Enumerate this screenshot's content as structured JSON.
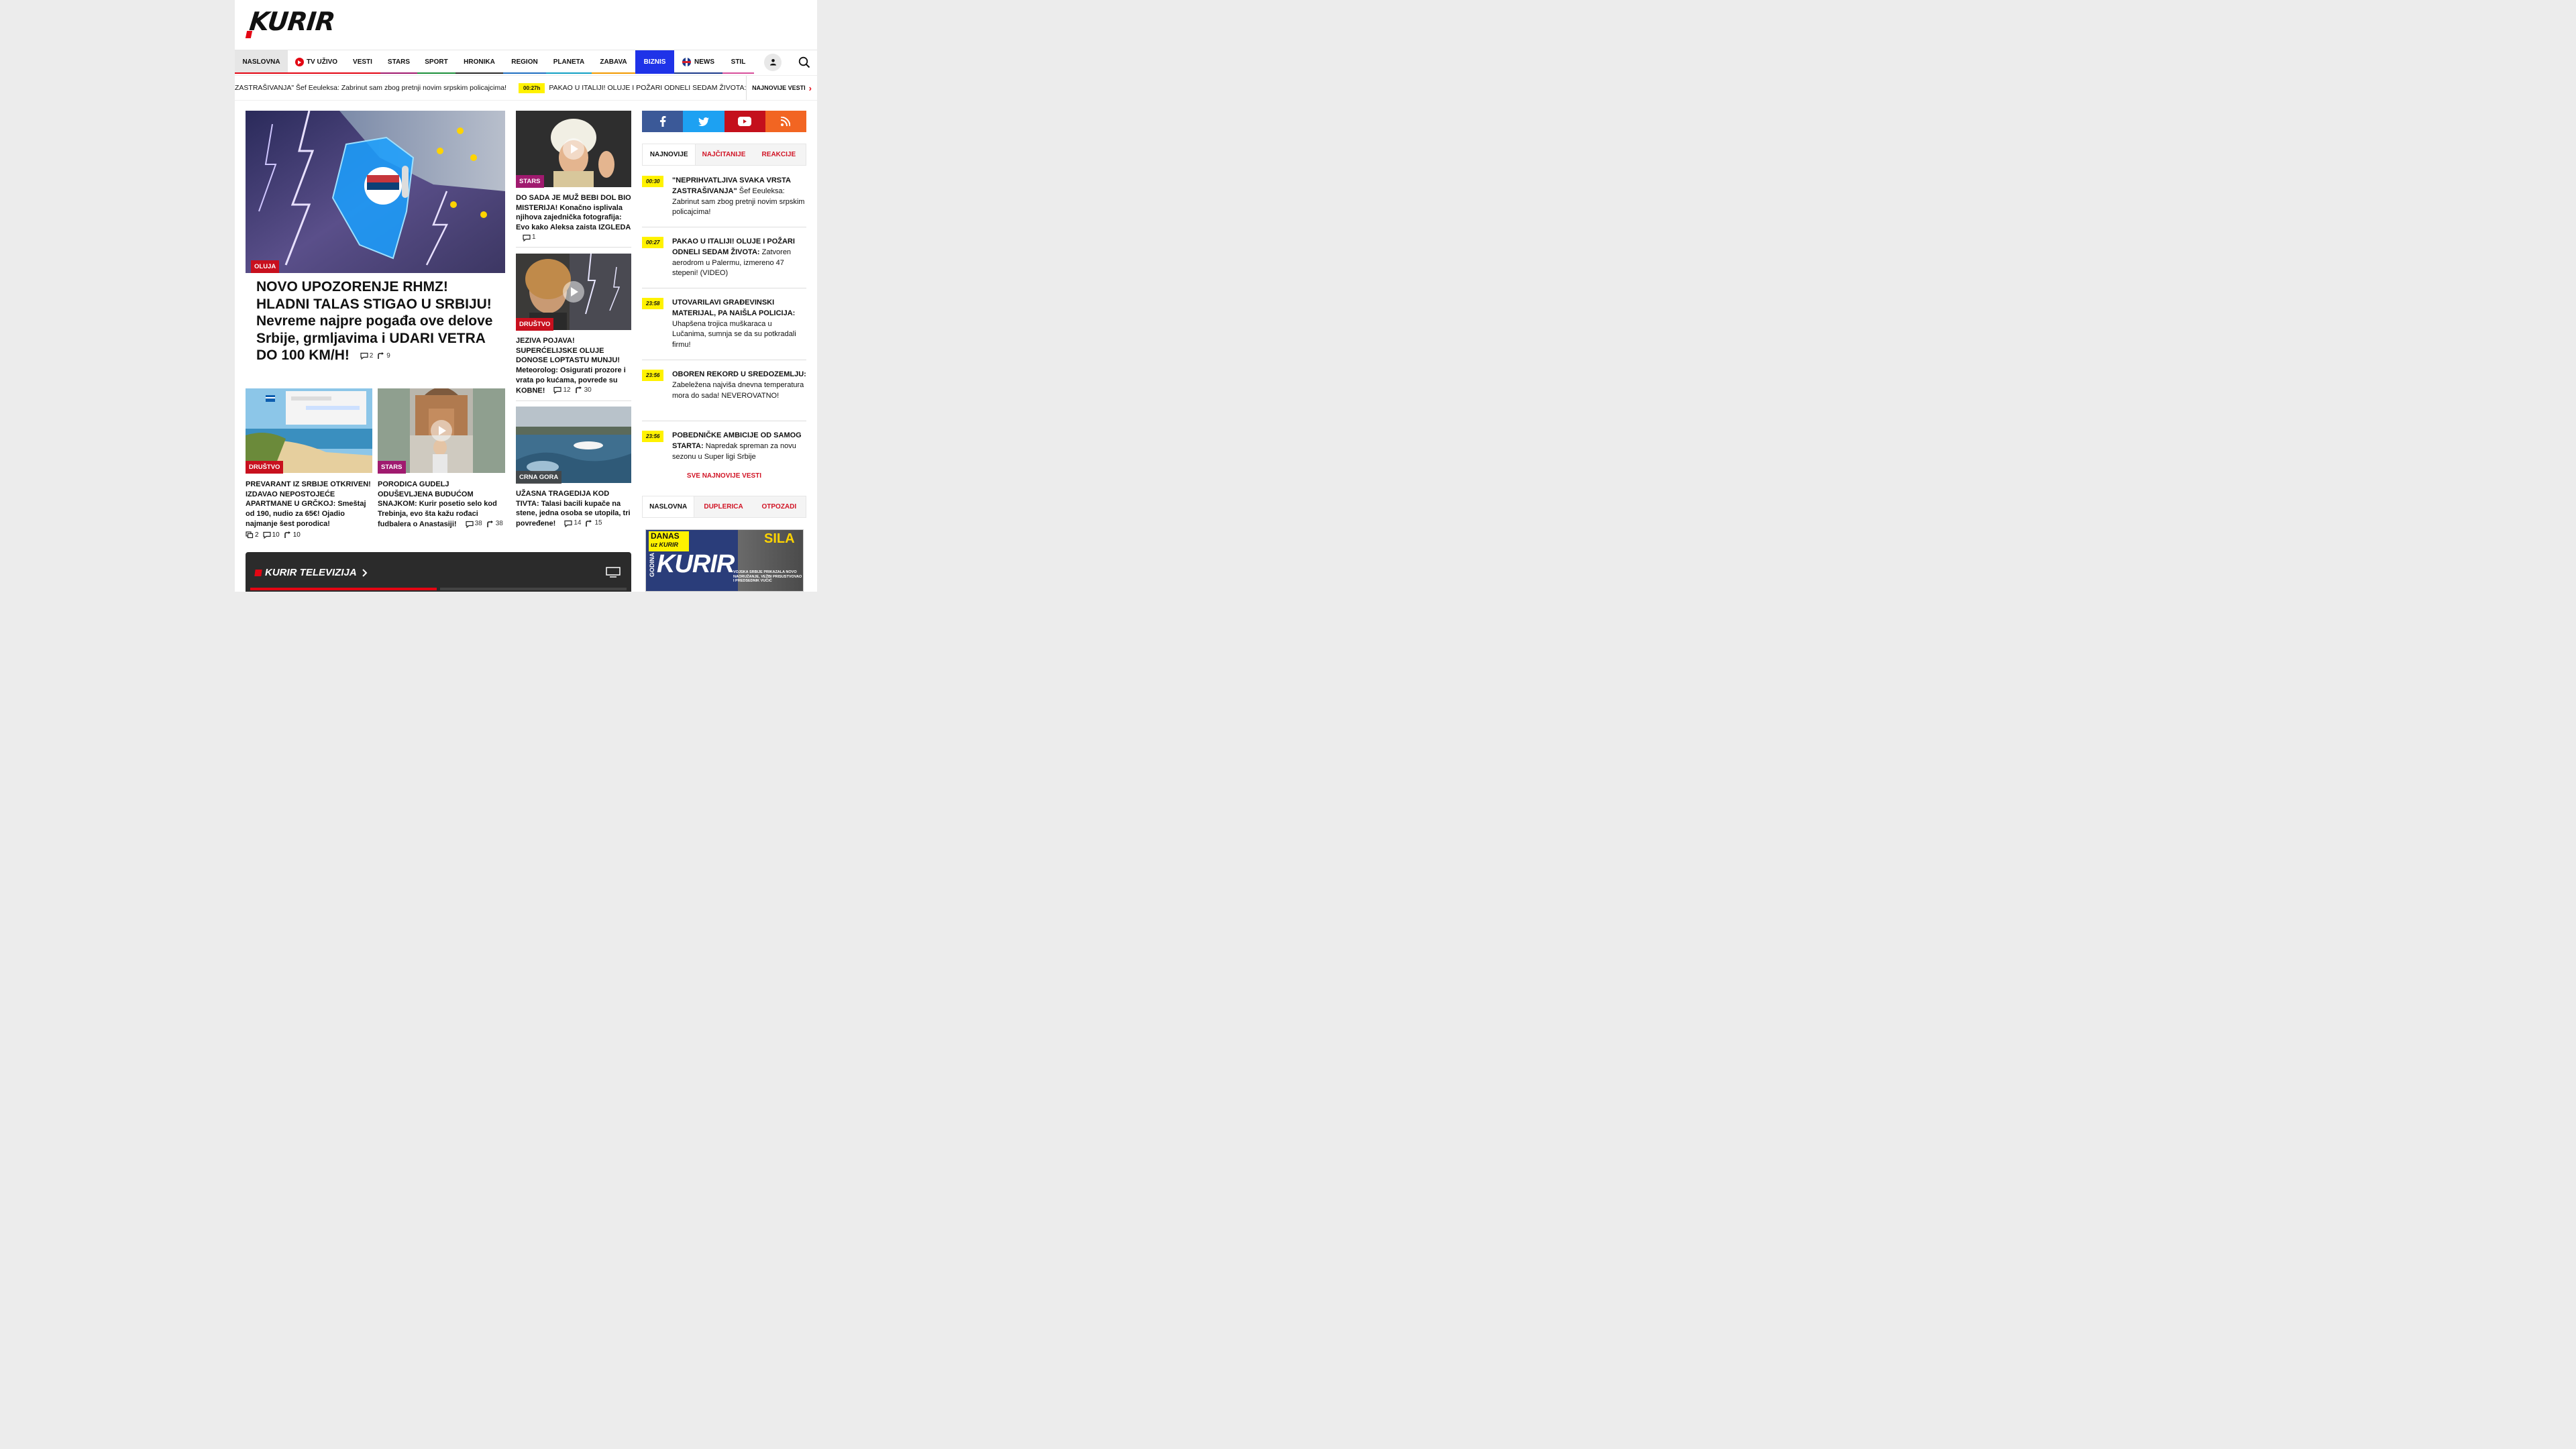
{
  "brand": {
    "logo_text": "KURIR",
    "accent": "#e30613"
  },
  "nav": {
    "items": [
      {
        "label": "NASLOVNA",
        "color": "#e30613"
      },
      {
        "label": "TV UŽIVO",
        "color": "#e30613"
      },
      {
        "label": "VESTI",
        "color": "#e30613"
      },
      {
        "label": "STARS",
        "color": "#a01a6f"
      },
      {
        "label": "SPORT",
        "color": "#1c8f3a"
      },
      {
        "label": "HRONIKA",
        "color": "#2b2b2b"
      },
      {
        "label": "REGION",
        "color": "#1f6fc1"
      },
      {
        "label": "PLANETA",
        "color": "#12a0c4"
      },
      {
        "label": "ZABAVA",
        "color": "#f29a00"
      },
      {
        "label": "BIZNIS",
        "color": "#1f33e8"
      },
      {
        "label": "NEWS",
        "color": "#1d3b8c"
      },
      {
        "label": "STIL",
        "color": "#d84f9b"
      }
    ]
  },
  "ticker": {
    "items": [
      {
        "time": "",
        "text": "ZASTRAŠIVANJA\" Šef Eeuleksa: Zabrinut sam zbog pretnji novim srpskim policajcima!"
      },
      {
        "time": "00:27h",
        "text": "PAKAO U ITALIJI! OLUJE I POŽARI ODNELI SEDAM ŽIVOTA: Zatvoren ae"
      }
    ],
    "more_label": "NAJNOVIJE VESTI"
  },
  "hero": {
    "category": "OLUJA",
    "title_part1": "NOVO UPOZORENJE RHMZ! HLADNI TALAS STIGAO U SRBIJU!",
    "title_part2": "Nevreme najpre pogađa ove delove Srbije, grmljavima i UDARI VETRA DO 100 KM/H!",
    "comments": "2",
    "shares": "9"
  },
  "cards_right": [
    {
      "category": "STARS",
      "title_bold": "DO SADA JE MUŽ BEBI DOL BIO MISTERIJA!",
      "title_rest": "Konačno isplivala njihova zajednička fotografija: Evo kako Aleksa zaista IZGLEDA",
      "comments": "1",
      "shares": ""
    },
    {
      "category": "DRUŠTVO",
      "title_bold": "JEZIVA POJAVA! SUPERĆELIJSKE OLUJE DONOSE LOPTASTU MUNJU!",
      "title_rest": "Meteorolog: Osigurati prozore i vrata po kućama, povrede su KOBNE!",
      "comments": "12",
      "shares": "30"
    },
    {
      "category": "CRNA GORA",
      "title_bold": "UŽASNA TRAGEDIJA KOD TIVTA:",
      "title_rest": "Talasi bacili kupače na stene, jedna osoba se utopila, tri povređene!",
      "comments": "14",
      "shares": "15"
    }
  ],
  "cards_bottom": [
    {
      "category": "DRUŠTVO",
      "title_bold": "PREVARANT IZ SRBIJE OTKRIVEN! IZDAVAO NEPOSTOJEĆE APARTMANE U GRČKOJ:",
      "title_rest": "Smeštaj od 190, nudio za 65€! Ojadio najmanje šest porodica!",
      "gallery": "2",
      "comments": "10",
      "shares": "10"
    },
    {
      "category": "STARS",
      "title_bold": "PORODICA GUDELJ ODUŠEVLJENA BUDUĆOM SNAJKOM:",
      "title_rest": "Kurir posetio selo kod Trebinja, evo šta kažu rođaci fudbalera o Anastasiji!",
      "comments": "38",
      "shares": "38"
    }
  ],
  "tv": {
    "title": "KURIR TELEVIZIJA"
  },
  "sidebar": {
    "tabs": [
      {
        "label": "NAJNOVIJE"
      },
      {
        "label": "NAJČITANIJE"
      },
      {
        "label": "REAKCIJE"
      }
    ],
    "news": [
      {
        "time": "00:30",
        "bold": "\"NEPRIHVATLJIVA SVAKA VRSTA ZASTRAŠIVANJA\"",
        "rest": "Šef Eeuleksa: Zabrinut sam zbog pretnji novim srpskim policajcima!"
      },
      {
        "time": "00:27",
        "bold": "PAKAO U ITALIJI! OLUJE I POŽARI ODNELI SEDAM ŽIVOTA:",
        "rest": "Zatvoren aerodrom u Palermu, izmereno 47 stepeni! (VIDEO)"
      },
      {
        "time": "23:58",
        "bold": "UTOVARILAVI GRAĐEVINSKI MATERIJAL, PA NAIŠLA POLICIJA:",
        "rest": "Uhapšena trojica muškaraca u Lučanima, sumnja se da su potkradali firmu!"
      },
      {
        "time": "23:56",
        "bold": "OBOREN REKORD U SREDOZEMLJU:",
        "rest": "Zabeležena najviša dnevna temperatura mora do sada! NEVEROVATNO!"
      },
      {
        "time": "23:56",
        "bold": "POBEDNIČKE AMBICIJE OD SAMOG STARTA:",
        "rest": "Napredak spreman za novu sezonu u Super ligi Srbije"
      }
    ],
    "all_news": "SVE NAJNOVIJE VESTI",
    "tabs2": [
      {
        "label": "NASLOVNA"
      },
      {
        "label": "DUPLERICA"
      },
      {
        "label": "OTPOZADI"
      }
    ],
    "paper": {
      "danas": "DANAS",
      "uz": "uz",
      "kurir": "KURIR",
      "sila": "SILA",
      "godina": "GODINA",
      "headline": "VOJSKA SRBIJE PRIKAZALA NOVO NAORUŽANJE, VEŽBI PRISUSTVOVAO I PREDSEDNIK VUČIĆ"
    }
  }
}
